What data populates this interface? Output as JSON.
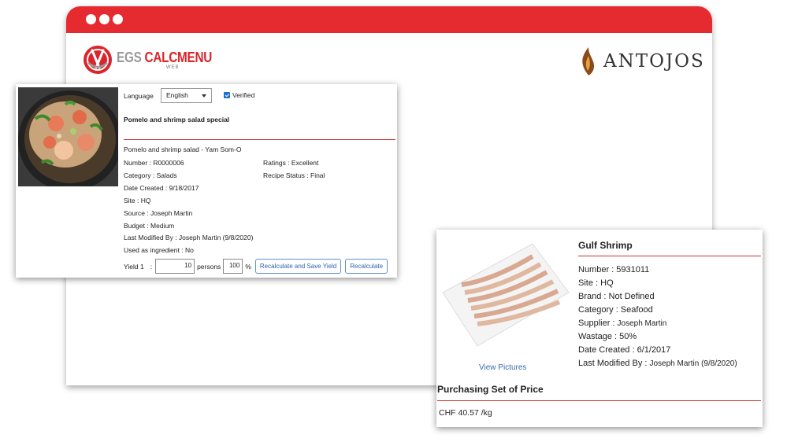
{
  "brand": {
    "left_logo_egs": "EGS",
    "left_logo_calcmenu": "CALCMENU",
    "left_logo_web": "WEB",
    "right_logo": "ANTOJOS"
  },
  "colors": {
    "accent": "#e52b2f",
    "divider": "#cc3333",
    "button_text": "#2f62b4",
    "link": "#3b6bb0"
  },
  "recipe": {
    "language_label": "Language",
    "language_value": "English",
    "verified_label": "Verified",
    "title": "Pomelo and shrimp salad special",
    "subtitle": "Pomelo and shrimp salad - Yam Som-O",
    "number": "Number : R0000006",
    "ratings": "Ratings : Excellent",
    "category": "Category : Salads",
    "status": "Recipe Status : Final",
    "date_created": "Date Created : 9/18/2017",
    "site": "Site : HQ",
    "source": "Source : Joseph Martin",
    "budget": "Budget : Medium",
    "last_modified": "Last Modified By : Joseph Martin (9/8/2020)",
    "used_as_ingredient": "Used as ingredient : No",
    "yield_label": "Yield 1",
    "yield_colon": ":",
    "yield_value": "10",
    "persons_label": "persons",
    "percent_value": "100",
    "percent_sign": "%",
    "btn_recalc_save": "Recalculate and Save Yield",
    "btn_recalc": "Recalculate"
  },
  "ingredient": {
    "title": "Gulf Shrimp",
    "number": "Number : 5931011",
    "site": "Site : HQ",
    "brand": "Brand : Not Defined",
    "category": "Category : Seafood",
    "supplier_label": "Supplier : ",
    "supplier_value": "Joseph Martin",
    "wastage": "Wastage : 50%",
    "date_created": "Date Created : 6/1/2017",
    "last_modified_label": "Last Modified By : ",
    "last_modified_value": "Joseph Martin (9/8/2020)",
    "view_pictures": "View Pictures",
    "purchasing_title": "Purchasing Set of Price",
    "price": "CHF 40.57 /kg"
  }
}
